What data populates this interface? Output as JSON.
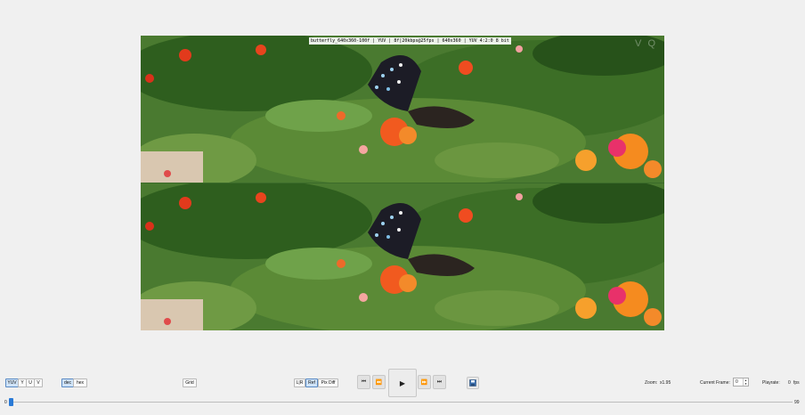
{
  "video_info": "butterfly_640x360-100f | YUV | 8f|20kbps@25fps | 640x360 | YUV 4:2:0 8 bit",
  "watermark": "V Q",
  "channel_buttons": [
    "YUV",
    "Y",
    "U",
    "V"
  ],
  "number_format_buttons": [
    "dec",
    "hex"
  ],
  "grid_label": "Grid",
  "view_buttons": [
    "L|R",
    "Ref",
    "Pix Diff"
  ],
  "transport_icons": [
    "skip-start",
    "step-back",
    "play",
    "step-forward",
    "skip-end"
  ],
  "save_icon": "save-icon",
  "zoom_label": "Zoom:",
  "zoom_value": "x1.95",
  "current_frame_label": "Current Frame:",
  "current_frame_value": "0",
  "playrate_label": "Playrate:",
  "playrate_value": "0",
  "playrate_unit": "fps",
  "slider_min": "0",
  "slider_max": "99",
  "slider_position": 0,
  "colors": {
    "accent": "#2a7ad6",
    "active_bg": "#cfe3f7"
  }
}
